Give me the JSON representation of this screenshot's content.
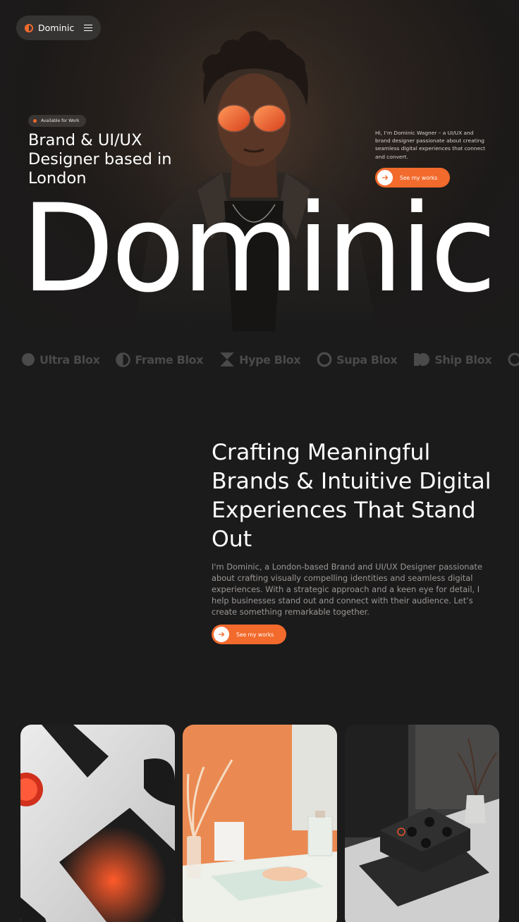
{
  "nav": {
    "brand": "Dominic"
  },
  "hero": {
    "badge": "Available for Work",
    "heading": "Brand & UI/UX Designer based in London",
    "intro": "Hi, I’m Dominic Wagner – a UI/UX and brand designer passionate about creating seamless digital experiences that connect and convert.",
    "cta_label": "See my works",
    "big_name": "Dominic"
  },
  "logos": [
    {
      "name": "Ultra Blox",
      "icon": "circle-icon"
    },
    {
      "name": "Frame Blox",
      "icon": "half-circle-icon"
    },
    {
      "name": "Hype Blox",
      "icon": "hourglass-icon"
    },
    {
      "name": "Supa Blox",
      "icon": "ring-icon"
    },
    {
      "name": "Ship Blox",
      "icon": "double-d-icon"
    }
  ],
  "about": {
    "title": "Crafting Meaningful Brands & Intuitive Digital Experiences That Stand Out",
    "text": "I'm Dominic, a London-based Brand and UI/UX Designer passionate about crafting visually compelling identities and seamless digital experiences. With a strategic approach and a keen eye for detail, I help businesses stand out and connect with their audience. Let’s create something remarkable together.",
    "cta_label": "See my works"
  },
  "colors": {
    "accent": "#f26a2c",
    "background": "#1b1b1b",
    "logo_gray": "#4a4a4a"
  }
}
